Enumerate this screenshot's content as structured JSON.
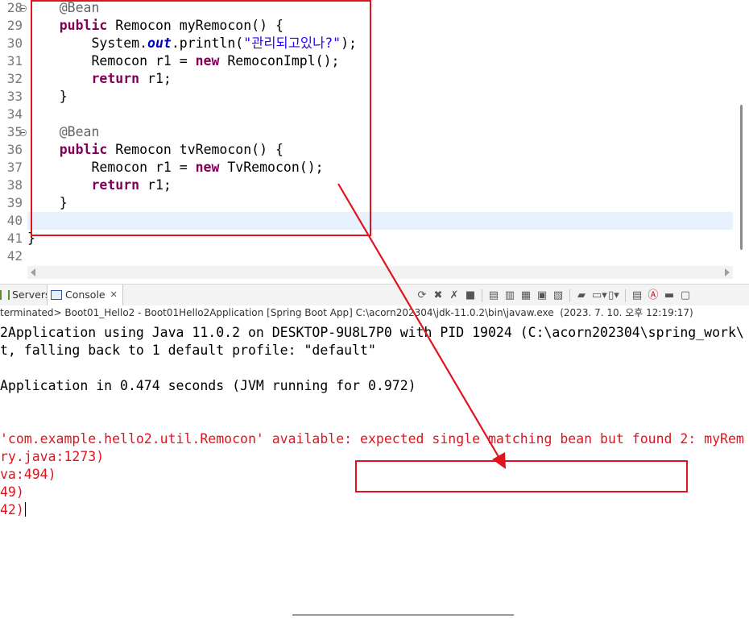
{
  "editor": {
    "lines": [
      {
        "num": "28",
        "fold": true,
        "tokens": [
          {
            "t": "    "
          },
          {
            "t": "@Bean",
            "c": "ann"
          }
        ]
      },
      {
        "num": "29",
        "fold": false,
        "tokens": [
          {
            "t": "    "
          },
          {
            "t": "public",
            "c": "kw"
          },
          {
            "t": " Remocon myRemocon() {"
          }
        ]
      },
      {
        "num": "30",
        "fold": false,
        "tokens": [
          {
            "t": "        System."
          },
          {
            "t": "out",
            "c": "fld"
          },
          {
            "t": ".println("
          },
          {
            "t": "\"관리되고있나?\"",
            "c": "str"
          },
          {
            "t": ");"
          }
        ]
      },
      {
        "num": "31",
        "fold": false,
        "tokens": [
          {
            "t": "        Remocon r1 = "
          },
          {
            "t": "new",
            "c": "kw"
          },
          {
            "t": " RemoconImpl();"
          }
        ]
      },
      {
        "num": "32",
        "fold": false,
        "tokens": [
          {
            "t": "        "
          },
          {
            "t": "return",
            "c": "kw"
          },
          {
            "t": " r1;"
          }
        ]
      },
      {
        "num": "33",
        "fold": false,
        "tokens": [
          {
            "t": "    }"
          }
        ]
      },
      {
        "num": "34",
        "fold": false,
        "tokens": [
          {
            "t": ""
          }
        ]
      },
      {
        "num": "35",
        "fold": true,
        "tokens": [
          {
            "t": "    "
          },
          {
            "t": "@Bean",
            "c": "ann"
          }
        ]
      },
      {
        "num": "36",
        "fold": false,
        "tokens": [
          {
            "t": "    "
          },
          {
            "t": "public",
            "c": "kw"
          },
          {
            "t": " Remocon tvRemocon() {"
          }
        ]
      },
      {
        "num": "37",
        "fold": false,
        "tokens": [
          {
            "t": "        Remocon r1 = "
          },
          {
            "t": "new",
            "c": "kw"
          },
          {
            "t": " TvRemocon();"
          }
        ]
      },
      {
        "num": "38",
        "fold": false,
        "tokens": [
          {
            "t": "        "
          },
          {
            "t": "return",
            "c": "kw"
          },
          {
            "t": " r1;"
          }
        ]
      },
      {
        "num": "39",
        "fold": false,
        "tokens": [
          {
            "t": "    }"
          }
        ]
      },
      {
        "num": "40",
        "fold": false,
        "current": true,
        "tokens": [
          {
            "t": ""
          }
        ]
      },
      {
        "num": "41",
        "fold": false,
        "tokens": [
          {
            "t": "}"
          }
        ]
      },
      {
        "num": "42",
        "fold": false,
        "tokens": [
          {
            "t": ""
          }
        ]
      }
    ]
  },
  "panel": {
    "tabs": {
      "servers": "Servers",
      "console": "Console",
      "console_close": "✕"
    },
    "toolbar_icons": [
      "pin-icon",
      "remove-launch-icon",
      "remove-all-icon",
      "stop-icon",
      "copy-icon",
      "scroll-lock-icon",
      "word-wrap-icon",
      "show-on-output-icon",
      "show-on-error-icon",
      "new-console-icon",
      "display-console-icon",
      "open-console-icon",
      "view-menu-icon",
      "minimize-icon",
      "maximize-icon"
    ],
    "status": "terminated> Boot01_Hello2 - Boot01Hello2Application [Spring Boot App] C:\\acorn202304\\jdk-11.0.2\\bin\\javaw.exe  (2023. 7. 10. 오후 12:19:17)"
  },
  "console": {
    "lines": [
      {
        "text": "2Application using Java 11.0.2 on DESKTOP-9U8L7P0 with PID 19024 (C:\\acorn202304\\spring_work\\",
        "err": false
      },
      {
        "text": "t, falling back to 1 default profile: \"default\"",
        "err": false
      },
      {
        "text": "",
        "err": false
      },
      {
        "text": "Application in 0.474 seconds (JVM running for 0.972)",
        "err": false
      },
      {
        "text": "",
        "err": false
      },
      {
        "text": "",
        "err": false
      },
      {
        "text": "'com.example.hello2.util.Remocon' available: expected single matching bean but found 2: myRem",
        "err": true
      },
      {
        "text": "ry.java:1273)",
        "err": true
      },
      {
        "text": "va:494)",
        "err": true
      },
      {
        "text": "49)",
        "err": true
      },
      {
        "text": "42)",
        "err": true,
        "caret": true
      }
    ]
  },
  "colors": {
    "annotation": "#e0141e",
    "keyword": "#7f0055",
    "string": "#2a00ff",
    "error": "#e0141e"
  }
}
